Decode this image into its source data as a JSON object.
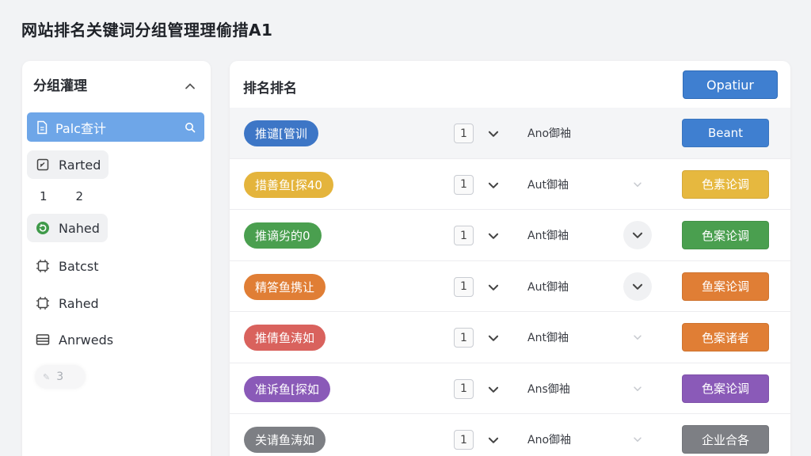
{
  "app": {
    "title": "网站排名关键词分组管理理偷措A1"
  },
  "sidebar": {
    "title": "分组灌理",
    "search_label": "Palc查计",
    "chips": [
      {
        "label": "Rarted",
        "icon": "edit-square-icon"
      },
      {
        "label": "Nahed",
        "icon": "green-refresh-icon"
      }
    ],
    "pagination": [
      "1",
      "2"
    ],
    "items": [
      {
        "label": "Batcst",
        "icon": "chip-icon"
      },
      {
        "label": "Rahed",
        "icon": "chip-icon"
      },
      {
        "label": "Anrweds",
        "icon": "list-icon"
      }
    ],
    "footer": {
      "label": "3"
    }
  },
  "main": {
    "title": "排名排名",
    "primary_button": "Opatiur",
    "rows": [
      {
        "pill": "推谴[管训",
        "pill_color": "#3d76c6",
        "num": "1",
        "text": "Ano御袖",
        "button": "Beant",
        "button_color": "#3f7fd0",
        "right_chevron": "none"
      },
      {
        "pill": "措善鱼[探40",
        "pill_color": "#e4b43c",
        "num": "1",
        "text": "Aut御袖",
        "button": "色素论调",
        "button_color": "#e6b83f",
        "right_chevron": "light"
      },
      {
        "pill": "推谪劣的0",
        "pill_color": "#4a9f4f",
        "num": "1",
        "text": "Ant御袖",
        "button": "色案论调",
        "button_color": "#4a9f4f",
        "right_chevron": "circle"
      },
      {
        "pill": "精答鱼携让",
        "pill_color": "#e07e35",
        "num": "1",
        "text": "Aut御袖",
        "button": "鱼案论调",
        "button_color": "#e07e35",
        "right_chevron": "circle"
      },
      {
        "pill": "推倩鱼涛如",
        "pill_color": "#d9625d",
        "num": "1",
        "text": "Ant御袖",
        "button": "色案诸者",
        "button_color": "#e07e35",
        "right_chevron": "light"
      },
      {
        "pill": "准诉鱼[探如",
        "pill_color": "#8a5ab8",
        "num": "1",
        "text": "Ans御袖",
        "button": "色案论调",
        "button_color": "#8a5ab8",
        "right_chevron": "light"
      },
      {
        "pill": "关请鱼涛如",
        "pill_color": "#7d7f84",
        "num": "1",
        "text": "Ano御袖",
        "button": "企业合各",
        "button_color": "#7d7f84",
        "right_chevron": "light"
      }
    ]
  }
}
